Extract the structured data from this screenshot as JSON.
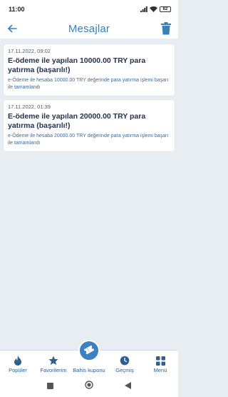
{
  "status_bar": {
    "time": "11:00",
    "battery": "82"
  },
  "header": {
    "title": "Mesajlar"
  },
  "messages": [
    {
      "date": "17.11.2022, 09:02",
      "title": "E-ödeme ile yapılan 10000.00 TRY para yatırma (başarılı!)",
      "body": "e-Ödeme ile hesaba 10000.00 TRY değerinde para yatırma işlemi başarı ile tamamlandı"
    },
    {
      "date": "17.11.2022, 01:39",
      "title": "E-ödeme ile yapılan 20000.00 TRY para yatırma (başarılı!)",
      "body": "e-Ödeme ile hesaba 20000.00 TRY değerinde para yatırma işlemi başarı ile tamamlandı"
    }
  ],
  "nav": {
    "popular": "Popüler",
    "favorites": "Favorilerim",
    "betslip": "Bahis kuponu",
    "history": "Geçmiş",
    "menu": "Menü"
  },
  "colors": {
    "accent": "#3d82c0",
    "title": "#3b7fb5",
    "background": "#e8edf2"
  }
}
